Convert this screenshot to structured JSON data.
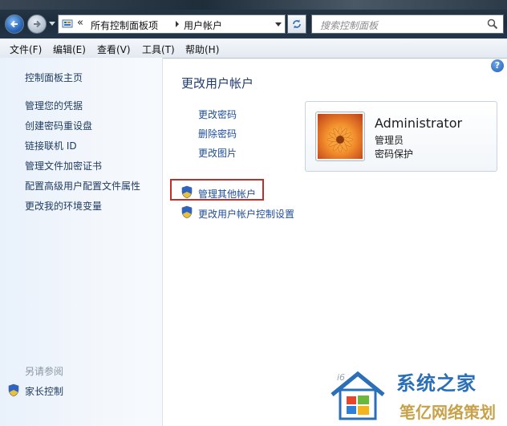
{
  "nav": {
    "breadcrumb_overflow": "«",
    "breadcrumbs": [
      "所有控制面板项",
      "用户帐户"
    ],
    "search_placeholder": "搜索控制面板"
  },
  "menu": [
    "文件(F)",
    "编辑(E)",
    "查看(V)",
    "工具(T)",
    "帮助(H)"
  ],
  "sidebar": {
    "home": "控制面板主页",
    "items": [
      "管理您的凭据",
      "创建密码重设盘",
      "链接联机 ID",
      "管理文件加密证书",
      "配置高级用户配置文件属性",
      "更改我的环境变量"
    ],
    "see_also_heading": "另请参阅",
    "see_also_items": [
      "家长控制"
    ]
  },
  "main": {
    "title": "更改用户帐户",
    "tasks": [
      "更改密码",
      "删除密码",
      "更改图片"
    ],
    "admin_tasks": [
      "管理其他帐户",
      "更改用户帐户控制设置"
    ]
  },
  "account": {
    "name": "Administrator",
    "role": "管理员",
    "password_status": "密码保护"
  },
  "watermark": {
    "brand": "系统之家",
    "subtitle": "笔亿网络策划",
    "url_fragment": "i6"
  },
  "colors": {
    "link": "#1f4e9a",
    "highlight_box": "#c0302a",
    "title": "#1e3a6e"
  },
  "icons": [
    "back-arrow-icon",
    "forward-arrow-icon",
    "control-panel-icon",
    "refresh-icon",
    "search-icon",
    "help-icon",
    "uac-shield-icon",
    "flower-avatar-icon",
    "windows-logo-icon"
  ]
}
